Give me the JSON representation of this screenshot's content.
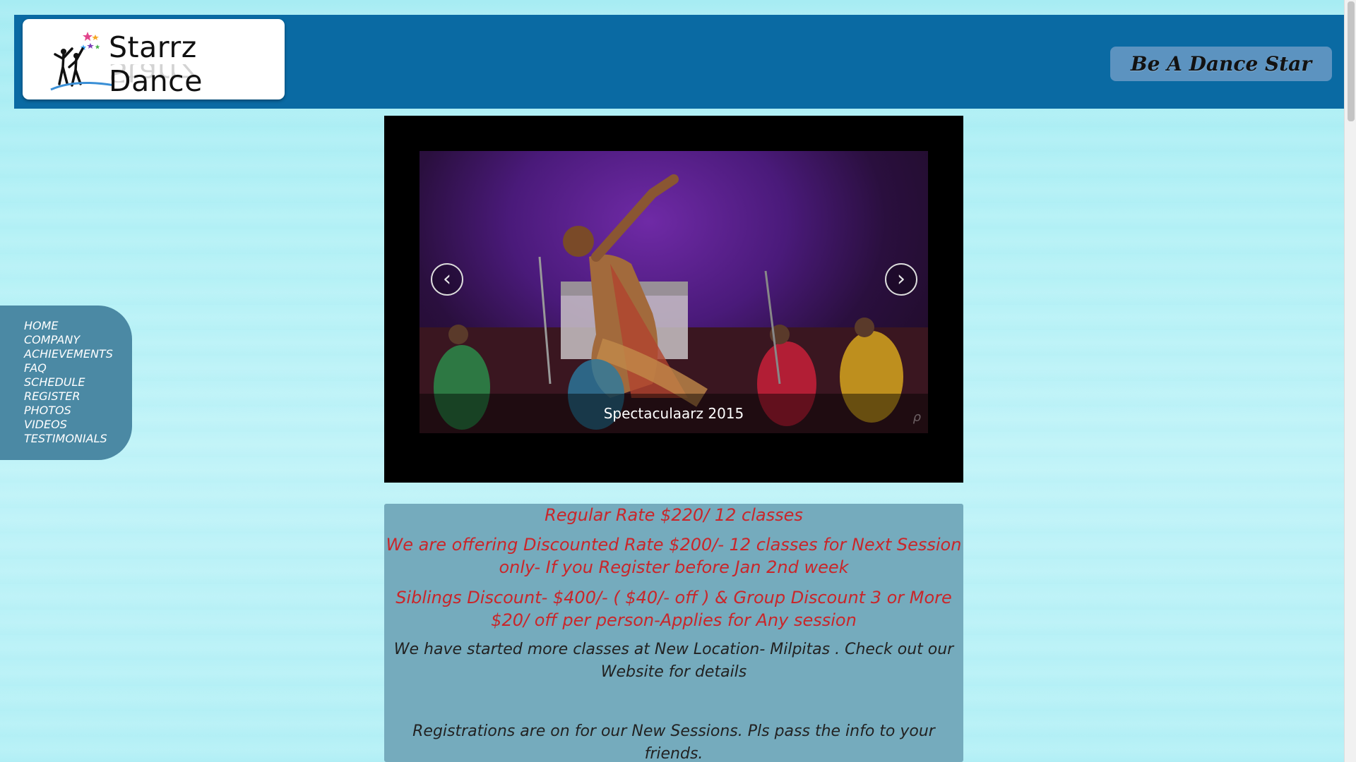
{
  "header": {
    "logo_text": "Starrz Dance",
    "tagline": "Be A Dance Star"
  },
  "sidenav": {
    "items": [
      {
        "label": "HOME"
      },
      {
        "label": "COMPANY"
      },
      {
        "label": "ACHIEVEMENTS"
      },
      {
        "label": "FAQ"
      },
      {
        "label": "SCHEDULE"
      },
      {
        "label": "REGISTER"
      },
      {
        "label": "PHOTOS"
      },
      {
        "label": "VIDEOS"
      },
      {
        "label": "TESTIMONIALS"
      }
    ]
  },
  "slider": {
    "caption": "Spectaculaarz 2015",
    "prev_icon": "chevron-left-icon",
    "next_icon": "chevron-right-icon"
  },
  "info": {
    "regular_rate": "Regular Rate $220/ 12 classes",
    "discount_rate": "We are offering Discounted Rate $200/- 12 classes for Next Session only- If you Register before Jan 2nd week",
    "siblings_discount": "Siblings Discount- $400/- ( $40/- off ) & Group Discount 3 or More $20/ off  per person-Applies for Any session",
    "new_location": "We have started more classes at New Location- Milpitas . Check out our Website for details",
    "registrations": "Registrations are on for our New Sessions. Pls pass the info to your friends."
  },
  "colors": {
    "header_bg": "#0a6aa3",
    "nav_bg": "#4b89a4",
    "panel_bg": "#75abbd",
    "accent_red": "#c9262a"
  }
}
